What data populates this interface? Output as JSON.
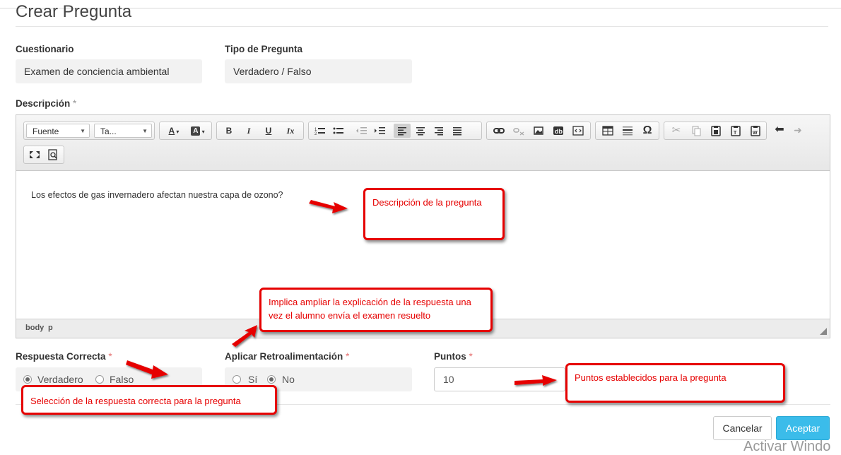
{
  "page": {
    "title": "Crear Pregunta"
  },
  "fields": {
    "cuestionario": {
      "label": "Cuestionario",
      "value": "Examen de conciencia ambiental"
    },
    "tipo": {
      "label": "Tipo de Pregunta",
      "value": "Verdadero / Falso"
    },
    "descripcion": {
      "label": "Descripción",
      "required": "*"
    }
  },
  "toolbar": {
    "font_combo": "Fuente",
    "size_combo": "Ta...",
    "bold": "B",
    "italic": "I",
    "underline": "U",
    "remove_format": "Ix"
  },
  "editor": {
    "content": "Los efectos de gas invernadero afectan nuestra capa de ozono?",
    "path": [
      "body",
      "p"
    ]
  },
  "respuesta": {
    "label": "Respuesta Correcta",
    "required": "*",
    "options": [
      "Verdadero",
      "Falso"
    ],
    "selected": "Verdadero"
  },
  "retro": {
    "label": "Aplicar Retroalimentación",
    "required": "*",
    "options": [
      "Sí",
      "No"
    ],
    "selected": "No"
  },
  "puntos": {
    "label": "Puntos",
    "required": "*",
    "value": "10"
  },
  "actions": {
    "cancel": "Cancelar",
    "accept": "Aceptar"
  },
  "annotations": {
    "descripcion": "Descripción de la pregunta",
    "retro": "Implica ampliar la explicación de la respuesta una vez el alumno envía el examen resuelto",
    "puntos": "Puntos establecidos para la pregunta",
    "respuesta": "Selección de la respuesta correcta para la pregunta"
  },
  "watermark": "Activar Windo",
  "colors": {
    "annotation": "#e60000",
    "primary": "#3bbcea"
  }
}
